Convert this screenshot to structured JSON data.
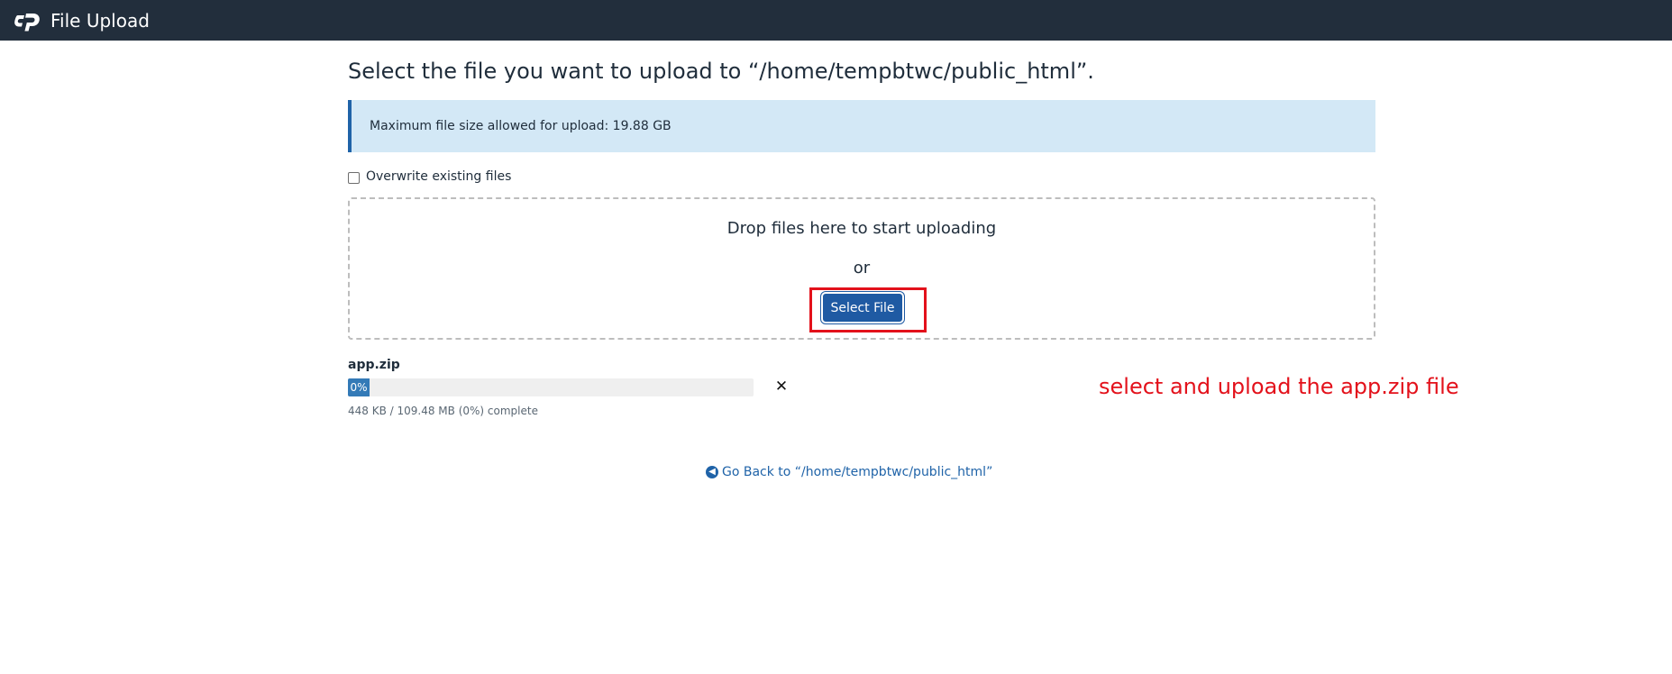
{
  "header": {
    "title": "File Upload",
    "logo_icon": "cpanel-logo-icon"
  },
  "main": {
    "heading": "Select the file you want to upload to “/home/tempbtwc/public_html”.",
    "info": "Maximum file size allowed for upload: 19.88 GB",
    "overwrite_label": "Overwrite existing files",
    "overwrite_checked": false,
    "dropzone": {
      "text": "Drop files here to start uploading",
      "or": "or",
      "button": "Select File"
    },
    "upload": {
      "file_name": "app.zip",
      "progress_percent": 0,
      "progress_label": "0%",
      "status": "448 KB / 109.48 MB (0%) complete",
      "cancel_icon": "close-icon"
    },
    "back_link": "Go Back to “/home/tempbtwc/public_html”"
  },
  "annotation": {
    "text": "select and upload the app.zip file",
    "color": "#e3111b"
  },
  "colors": {
    "topbar": "#222e3c",
    "accent": "#1f5aa3",
    "info_bg": "#d3e8f6"
  }
}
